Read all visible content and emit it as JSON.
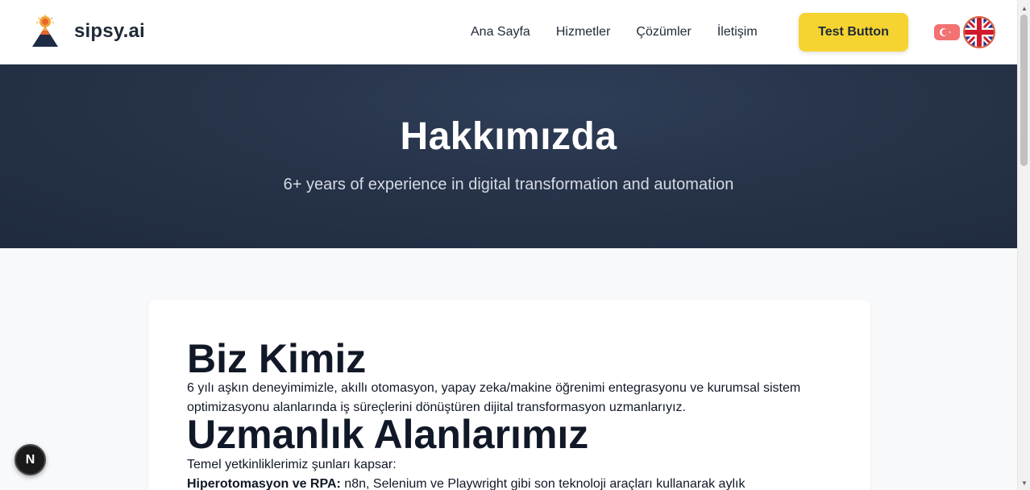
{
  "header": {
    "brand": "sipsy.ai",
    "nav": [
      "Ana Sayfa",
      "Hizmetler",
      "Çözümler",
      "İletişim"
    ],
    "cta_label": "Test Button",
    "languages": [
      "tr-flag-icon",
      "uk-flag-icon"
    ]
  },
  "hero": {
    "title": "Hakkımızda",
    "subtitle": "6+ years of experience in digital transformation and automation"
  },
  "content": {
    "who_title": "Biz Kimiz",
    "who_text": "6 yılı aşkın deneyimimizle, akıllı otomasyon, yapay zeka/makine öğrenimi entegrasyonu ve kurumsal sistem optimizasyonu alanlarında iş süreçlerini dönüştüren dijital transformasyon uzmanlarıyız.",
    "expertise_title": "Uzmanlık Alanlarımız",
    "core_text": "Temel yetkinliklerimiz şunları kapsar:",
    "hyper_label": "Hiperotomasyon ve RPA:",
    "hyper_text": " n8n, Selenium ve Playwright gibi son teknoloji araçları kullanarak aylık"
  },
  "floating": {
    "badge_letter": "N"
  },
  "colors": {
    "accent": "#f5d431",
    "hero_bg": "#263349",
    "text": "#111827"
  }
}
